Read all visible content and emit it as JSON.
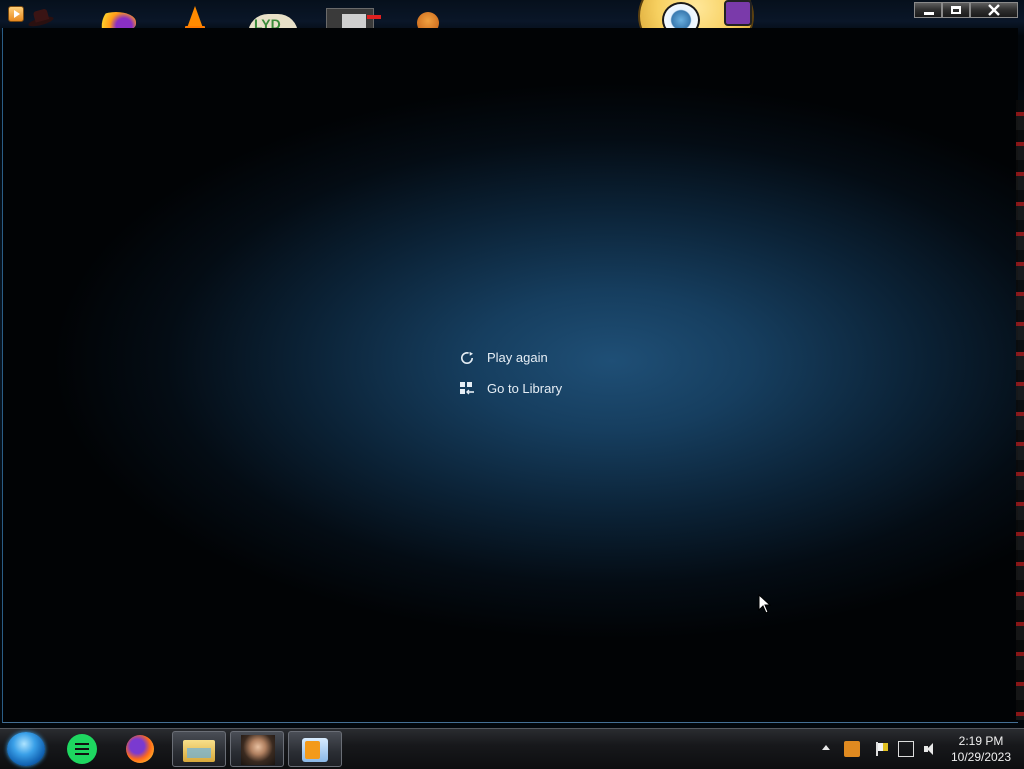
{
  "menu": {
    "play_again": "Play again",
    "go_to_library": "Go to Library"
  },
  "icons": {
    "play_again": "refresh-icon",
    "go_to_library": "library-icon"
  },
  "window": {
    "controls": [
      "minimize",
      "maximize",
      "close"
    ]
  },
  "taskbar": {
    "apps": [
      "spotify",
      "firefox",
      "file-explorer",
      "photo-viewer",
      "media-player"
    ],
    "active_apps": [
      "file-explorer",
      "photo-viewer",
      "media-player"
    ]
  },
  "clock": {
    "time": "2:19 PM",
    "date": "10/29/2023"
  },
  "colors": {
    "background_glow": "#1d4a6e",
    "menu_text": "#e6eef5",
    "start_orb": "#3aa0e8"
  }
}
